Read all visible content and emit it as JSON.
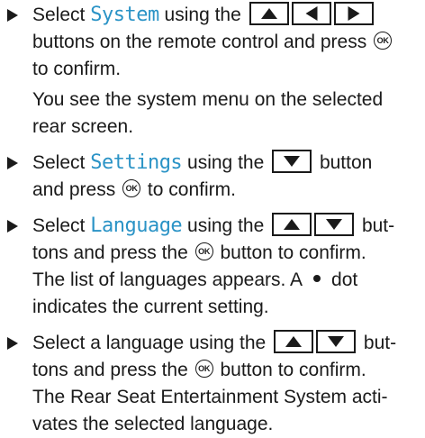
{
  "step1": {
    "t1": "Select",
    "kw": "System",
    "t2": "using the",
    "buttons": [
      "up",
      "left",
      "right"
    ],
    "l2": "buttons on the remote control and press",
    "ok": "OK",
    "l3": "to confirm.",
    "l4": "You see the system menu on the selected",
    "l5": "rear screen."
  },
  "step2": {
    "t1": "Select",
    "kw": "Settings",
    "t2": "using the",
    "t3": "button",
    "l2a": "and press",
    "ok": "OK",
    "l2b": "to confirm."
  },
  "step3": {
    "t1": "Select",
    "kw": "Language",
    "t2": "using the",
    "t3": "but-",
    "l2a": "tons and press the",
    "ok": "OK",
    "l2b": "button to confirm.",
    "l3": "The list of languages appears. A",
    "l3b": "dot",
    "l4": "indicates the current setting."
  },
  "step4": {
    "t1": "Select a language using the",
    "t3": "but-",
    "l2a": "tons and press the",
    "ok": "OK",
    "l2b": "button to confirm.",
    "l3": "The Rear Seat Entertainment System acti-",
    "l4": "vates the selected language."
  }
}
